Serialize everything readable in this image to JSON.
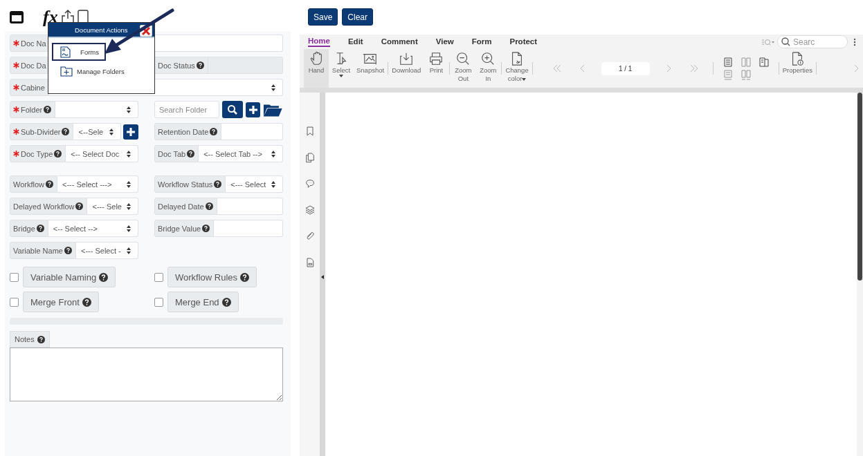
{
  "top_bar": {
    "formula_label": "fx"
  },
  "popup": {
    "title": "Document Actions",
    "items": [
      {
        "label": "Forms",
        "kind": "form",
        "selected": true
      },
      {
        "label": "Manage Folders",
        "kind": "folder",
        "selected": false
      }
    ]
  },
  "form": {
    "groups": [
      [
        {
          "fields": [
            {
              "label": "Doc Na",
              "required": true,
              "help": false,
              "wide": true,
              "control": {
                "kind": "input"
              }
            }
          ]
        },
        {
          "fields": [
            {
              "label": "Doc Da",
              "required": true,
              "help": false
            },
            {
              "label": "Doc Status",
              "required": false,
              "help": true,
              "wide": false,
              "control": {
                "kind": "readonly"
              }
            }
          ]
        },
        {
          "fields": [
            {
              "label": "Cabine",
              "required": true,
              "help": false,
              "wide": true,
              "control": {
                "kind": "select"
              }
            }
          ]
        },
        {
          "fields": [
            {
              "label": "Folder",
              "required": true,
              "help": true,
              "wide": false,
              "control": {
                "kind": "select"
              }
            },
            {
              "kind": "search",
              "placeholder": "Search Folder"
            }
          ]
        },
        {
          "fields": [
            {
              "label": "Sub-Divider",
              "required": true,
              "help": true,
              "wide": false,
              "add_button": true,
              "control": {
                "kind": "select",
                "value": "<--Sele"
              }
            },
            {
              "label": "Retention Date",
              "required": false,
              "help": true,
              "wide": false,
              "control": {
                "kind": "input"
              }
            }
          ]
        },
        {
          "fields": [
            {
              "label": "Doc Type",
              "required": true,
              "help": true,
              "wide": false,
              "control": {
                "kind": "select",
                "value": "<-- Select Doc"
              }
            },
            {
              "label": "Doc Tab",
              "required": false,
              "help": true,
              "wide": false,
              "control": {
                "kind": "select",
                "value": "<-- Select Tab -->"
              }
            }
          ]
        }
      ],
      [
        {
          "fields": [
            {
              "label": "Workflow",
              "required": false,
              "help": true,
              "wide": false,
              "control": {
                "kind": "select",
                "value": "<--- Select --->"
              }
            },
            {
              "label": "Workflow Status",
              "required": false,
              "help": true,
              "wide": false,
              "control": {
                "kind": "select",
                "value": "<--- Select"
              }
            }
          ]
        },
        {
          "fields": [
            {
              "label": "Delayed Workflow",
              "required": false,
              "help": true,
              "wide": false,
              "control": {
                "kind": "select",
                "value": "<--- Sele"
              }
            },
            {
              "label": "Delayed Date",
              "required": false,
              "help": true,
              "wide": false,
              "control": {
                "kind": "input"
              }
            }
          ]
        },
        {
          "fields": [
            {
              "label": "Bridge",
              "required": false,
              "help": true,
              "wide": false,
              "control": {
                "kind": "select",
                "value": "<-- Select -->"
              }
            },
            {
              "label": "Bridge Value",
              "required": false,
              "help": true,
              "wide": false,
              "control": {
                "kind": "input"
              }
            }
          ]
        },
        {
          "fields": [
            {
              "label": "Variable Name",
              "required": false,
              "help": true,
              "wide": false,
              "control": {
                "kind": "select",
                "value": "<--- Select -"
              }
            }
          ]
        }
      ]
    ],
    "options": [
      {
        "label": "Variable Naming",
        "checked": false
      },
      {
        "label": "Workflow Rules",
        "checked": false
      },
      {
        "label": "Merge Front",
        "checked": false
      },
      {
        "label": "Merge End",
        "checked": false
      }
    ],
    "notes_label": "Notes"
  },
  "actions": [
    "Save",
    "Clear"
  ],
  "viewer": {
    "tabs": [
      {
        "label": "Home",
        "selected": true
      },
      {
        "label": "Edit",
        "selected": false
      },
      {
        "label": "Comment",
        "selected": false
      },
      {
        "label": "View",
        "selected": false
      },
      {
        "label": "Form",
        "selected": false
      },
      {
        "label": "Protect",
        "selected": false
      }
    ],
    "search_placeholder": "Searc",
    "tool_groups": [
      [
        {
          "kind": "hand",
          "label": "Hand",
          "selected": true,
          "menu": false
        },
        {
          "kind": "select",
          "label": "Select",
          "selected": false,
          "menu": true
        },
        {
          "kind": "snapshot",
          "label": "Snapshot",
          "selected": false,
          "menu": false
        }
      ],
      [
        {
          "kind": "download",
          "label": "Download",
          "selected": false,
          "menu": false
        },
        {
          "kind": "print",
          "label": "Print",
          "selected": false,
          "menu": false
        }
      ],
      [
        {
          "kind": "zoom_out",
          "label": "Zoom Out",
          "selected": false,
          "menu": false
        },
        {
          "kind": "zoom_in",
          "label": "Zoom In",
          "selected": false,
          "menu": false
        }
      ],
      [
        {
          "kind": "color",
          "label": "Change color",
          "selected": false,
          "menu": true
        }
      ]
    ],
    "page_value": "1 / 1",
    "properties_label": "Properties"
  }
}
